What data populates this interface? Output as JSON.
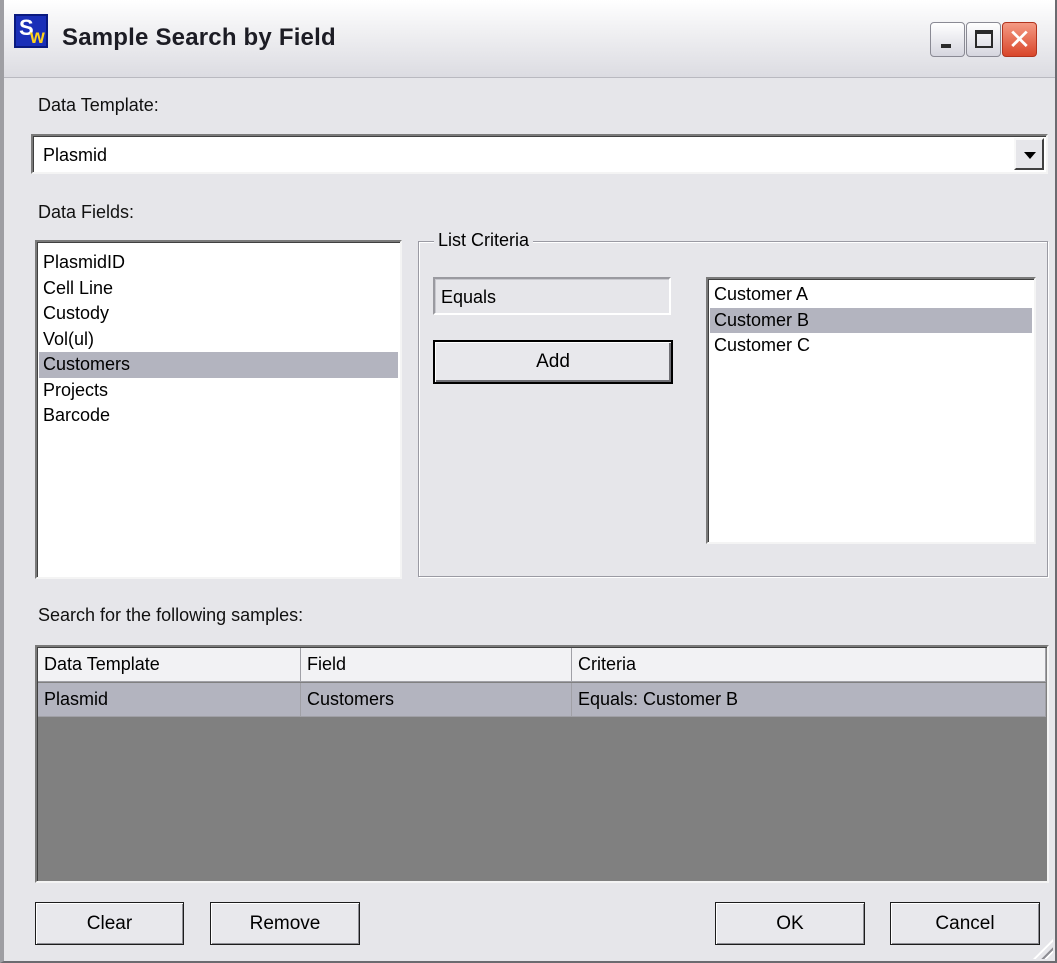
{
  "window": {
    "title": "Sample Search by Field",
    "icon": "sw-app-icon",
    "close_glyph": "✕"
  },
  "data_template": {
    "label": "Data Template:",
    "selected": "Plasmid"
  },
  "data_fields": {
    "label": "Data Fields:",
    "items": [
      {
        "label": "PlasmidID",
        "selected": false
      },
      {
        "label": "Cell Line",
        "selected": false
      },
      {
        "label": "Custody",
        "selected": false
      },
      {
        "label": "Vol(ul)",
        "selected": false
      },
      {
        "label": "Customers",
        "selected": true
      },
      {
        "label": "Projects",
        "selected": false
      },
      {
        "label": "Barcode",
        "selected": false
      }
    ]
  },
  "list_criteria": {
    "title": "List Criteria",
    "operator": "Equals",
    "add_label": "Add",
    "options": [
      {
        "label": "Customer A",
        "selected": false
      },
      {
        "label": "Customer B",
        "selected": true
      },
      {
        "label": "Customer C",
        "selected": false
      }
    ]
  },
  "results": {
    "label": "Search for the following samples:",
    "columns": [
      "Data Template",
      "Field",
      "Criteria"
    ],
    "rows": [
      {
        "template": "Plasmid",
        "field": "Customers",
        "criteria": "Equals: Customer B"
      }
    ]
  },
  "buttons": {
    "clear": "Clear",
    "remove": "Remove",
    "ok": "OK",
    "cancel": "Cancel"
  },
  "colors": {
    "selection": "#b3b4bf",
    "grid_empty": "#808080",
    "close_button": "#d9462a"
  }
}
